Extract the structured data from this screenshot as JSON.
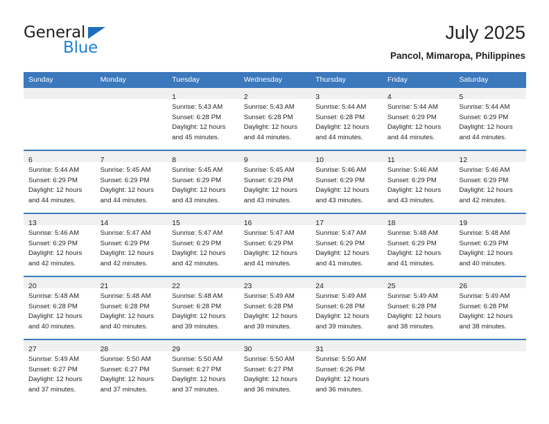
{
  "brand": {
    "name_part1": "General",
    "name_part2": "Blue",
    "triangle_icon": "blue-triangle-icon",
    "color_dark": "#231f20",
    "color_blue": "#1c7fd6"
  },
  "header": {
    "title": "July 2025",
    "subtitle": "Pancol, Mimaropa, Philippines"
  },
  "theme": {
    "header_blue": "#3b78bc",
    "daynum_band": "#f0f0f0",
    "text": "#231f20"
  },
  "weekday_headers": [
    "Sunday",
    "Monday",
    "Tuesday",
    "Wednesday",
    "Thursday",
    "Friday",
    "Saturday"
  ],
  "weeks": [
    [
      {
        "day": "",
        "sunrise": "",
        "sunset": "",
        "daylight_line1": "",
        "daylight_line2": ""
      },
      {
        "day": "",
        "sunrise": "",
        "sunset": "",
        "daylight_line1": "",
        "daylight_line2": ""
      },
      {
        "day": "1",
        "sunrise": "Sunrise: 5:43 AM",
        "sunset": "Sunset: 6:28 PM",
        "daylight_line1": "Daylight: 12 hours",
        "daylight_line2": "and 45 minutes."
      },
      {
        "day": "2",
        "sunrise": "Sunrise: 5:43 AM",
        "sunset": "Sunset: 6:28 PM",
        "daylight_line1": "Daylight: 12 hours",
        "daylight_line2": "and 44 minutes."
      },
      {
        "day": "3",
        "sunrise": "Sunrise: 5:44 AM",
        "sunset": "Sunset: 6:28 PM",
        "daylight_line1": "Daylight: 12 hours",
        "daylight_line2": "and 44 minutes."
      },
      {
        "day": "4",
        "sunrise": "Sunrise: 5:44 AM",
        "sunset": "Sunset: 6:29 PM",
        "daylight_line1": "Daylight: 12 hours",
        "daylight_line2": "and 44 minutes."
      },
      {
        "day": "5",
        "sunrise": "Sunrise: 5:44 AM",
        "sunset": "Sunset: 6:29 PM",
        "daylight_line1": "Daylight: 12 hours",
        "daylight_line2": "and 44 minutes."
      }
    ],
    [
      {
        "day": "6",
        "sunrise": "Sunrise: 5:44 AM",
        "sunset": "Sunset: 6:29 PM",
        "daylight_line1": "Daylight: 12 hours",
        "daylight_line2": "and 44 minutes."
      },
      {
        "day": "7",
        "sunrise": "Sunrise: 5:45 AM",
        "sunset": "Sunset: 6:29 PM",
        "daylight_line1": "Daylight: 12 hours",
        "daylight_line2": "and 44 minutes."
      },
      {
        "day": "8",
        "sunrise": "Sunrise: 5:45 AM",
        "sunset": "Sunset: 6:29 PM",
        "daylight_line1": "Daylight: 12 hours",
        "daylight_line2": "and 43 minutes."
      },
      {
        "day": "9",
        "sunrise": "Sunrise: 5:45 AM",
        "sunset": "Sunset: 6:29 PM",
        "daylight_line1": "Daylight: 12 hours",
        "daylight_line2": "and 43 minutes."
      },
      {
        "day": "10",
        "sunrise": "Sunrise: 5:46 AM",
        "sunset": "Sunset: 6:29 PM",
        "daylight_line1": "Daylight: 12 hours",
        "daylight_line2": "and 43 minutes."
      },
      {
        "day": "11",
        "sunrise": "Sunrise: 5:46 AM",
        "sunset": "Sunset: 6:29 PM",
        "daylight_line1": "Daylight: 12 hours",
        "daylight_line2": "and 43 minutes."
      },
      {
        "day": "12",
        "sunrise": "Sunrise: 5:46 AM",
        "sunset": "Sunset: 6:29 PM",
        "daylight_line1": "Daylight: 12 hours",
        "daylight_line2": "and 42 minutes."
      }
    ],
    [
      {
        "day": "13",
        "sunrise": "Sunrise: 5:46 AM",
        "sunset": "Sunset: 6:29 PM",
        "daylight_line1": "Daylight: 12 hours",
        "daylight_line2": "and 42 minutes."
      },
      {
        "day": "14",
        "sunrise": "Sunrise: 5:47 AM",
        "sunset": "Sunset: 6:29 PM",
        "daylight_line1": "Daylight: 12 hours",
        "daylight_line2": "and 42 minutes."
      },
      {
        "day": "15",
        "sunrise": "Sunrise: 5:47 AM",
        "sunset": "Sunset: 6:29 PM",
        "daylight_line1": "Daylight: 12 hours",
        "daylight_line2": "and 42 minutes."
      },
      {
        "day": "16",
        "sunrise": "Sunrise: 5:47 AM",
        "sunset": "Sunset: 6:29 PM",
        "daylight_line1": "Daylight: 12 hours",
        "daylight_line2": "and 41 minutes."
      },
      {
        "day": "17",
        "sunrise": "Sunrise: 5:47 AM",
        "sunset": "Sunset: 6:29 PM",
        "daylight_line1": "Daylight: 12 hours",
        "daylight_line2": "and 41 minutes."
      },
      {
        "day": "18",
        "sunrise": "Sunrise: 5:48 AM",
        "sunset": "Sunset: 6:29 PM",
        "daylight_line1": "Daylight: 12 hours",
        "daylight_line2": "and 41 minutes."
      },
      {
        "day": "19",
        "sunrise": "Sunrise: 5:48 AM",
        "sunset": "Sunset: 6:29 PM",
        "daylight_line1": "Daylight: 12 hours",
        "daylight_line2": "and 40 minutes."
      }
    ],
    [
      {
        "day": "20",
        "sunrise": "Sunrise: 5:48 AM",
        "sunset": "Sunset: 6:28 PM",
        "daylight_line1": "Daylight: 12 hours",
        "daylight_line2": "and 40 minutes."
      },
      {
        "day": "21",
        "sunrise": "Sunrise: 5:48 AM",
        "sunset": "Sunset: 6:28 PM",
        "daylight_line1": "Daylight: 12 hours",
        "daylight_line2": "and 40 minutes."
      },
      {
        "day": "22",
        "sunrise": "Sunrise: 5:48 AM",
        "sunset": "Sunset: 6:28 PM",
        "daylight_line1": "Daylight: 12 hours",
        "daylight_line2": "and 39 minutes."
      },
      {
        "day": "23",
        "sunrise": "Sunrise: 5:49 AM",
        "sunset": "Sunset: 6:28 PM",
        "daylight_line1": "Daylight: 12 hours",
        "daylight_line2": "and 39 minutes."
      },
      {
        "day": "24",
        "sunrise": "Sunrise: 5:49 AM",
        "sunset": "Sunset: 6:28 PM",
        "daylight_line1": "Daylight: 12 hours",
        "daylight_line2": "and 39 minutes."
      },
      {
        "day": "25",
        "sunrise": "Sunrise: 5:49 AM",
        "sunset": "Sunset: 6:28 PM",
        "daylight_line1": "Daylight: 12 hours",
        "daylight_line2": "and 38 minutes."
      },
      {
        "day": "26",
        "sunrise": "Sunrise: 5:49 AM",
        "sunset": "Sunset: 6:28 PM",
        "daylight_line1": "Daylight: 12 hours",
        "daylight_line2": "and 38 minutes."
      }
    ],
    [
      {
        "day": "27",
        "sunrise": "Sunrise: 5:49 AM",
        "sunset": "Sunset: 6:27 PM",
        "daylight_line1": "Daylight: 12 hours",
        "daylight_line2": "and 37 minutes."
      },
      {
        "day": "28",
        "sunrise": "Sunrise: 5:50 AM",
        "sunset": "Sunset: 6:27 PM",
        "daylight_line1": "Daylight: 12 hours",
        "daylight_line2": "and 37 minutes."
      },
      {
        "day": "29",
        "sunrise": "Sunrise: 5:50 AM",
        "sunset": "Sunset: 6:27 PM",
        "daylight_line1": "Daylight: 12 hours",
        "daylight_line2": "and 37 minutes."
      },
      {
        "day": "30",
        "sunrise": "Sunrise: 5:50 AM",
        "sunset": "Sunset: 6:27 PM",
        "daylight_line1": "Daylight: 12 hours",
        "daylight_line2": "and 36 minutes."
      },
      {
        "day": "31",
        "sunrise": "Sunrise: 5:50 AM",
        "sunset": "Sunset: 6:26 PM",
        "daylight_line1": "Daylight: 12 hours",
        "daylight_line2": "and 36 minutes."
      },
      {
        "day": "",
        "sunrise": "",
        "sunset": "",
        "daylight_line1": "",
        "daylight_line2": ""
      },
      {
        "day": "",
        "sunrise": "",
        "sunset": "",
        "daylight_line1": "",
        "daylight_line2": ""
      }
    ]
  ]
}
